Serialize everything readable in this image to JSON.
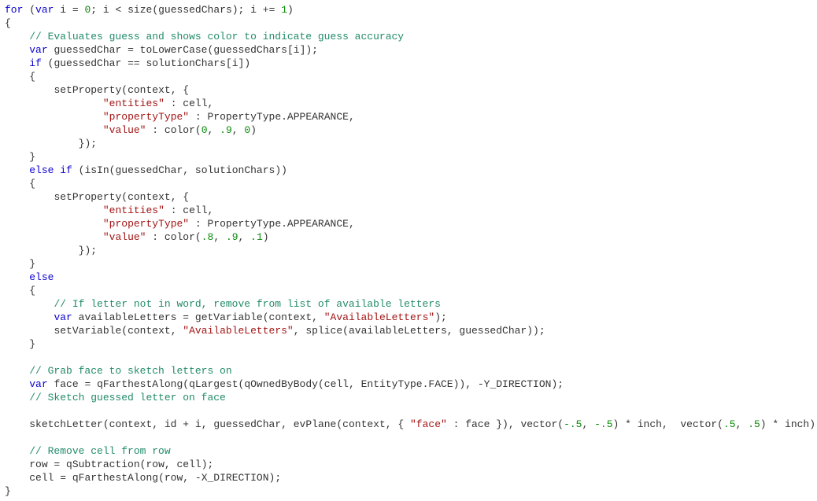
{
  "code": {
    "kw": {
      "for": "for",
      "var": "var",
      "if": "if",
      "elseif": "else if",
      "else": "else"
    },
    "comments": {
      "c1": "// Evaluates guess and shows color to indicate guess accuracy",
      "c2": "// If letter not in word, remove from list of available letters",
      "c3": "// Grab face to sketch letters on",
      "c4": "// Sketch guessed letter on face",
      "c5": "// Remove cell from row"
    },
    "strings": {
      "entities": "\"entities\"",
      "propertyType": "\"propertyType\"",
      "value": "\"value\"",
      "availLetters": "\"AvailableLetters\"",
      "face": "\"face\""
    },
    "nums": {
      "zero": "0",
      "one": "1",
      "p8": ".8",
      "p9": ".9",
      "p1": ".1",
      "p5": ".5",
      "m5": "-.5"
    },
    "tokens": {
      "i": "i",
      "size": "size",
      "guessedChars": "guessedChars",
      "guessedChar": "guessedChar",
      "toLowerCase": "toLowerCase",
      "solutionChars": "solutionChars",
      "setProperty": "setProperty",
      "context": "context",
      "cell": "cell",
      "PropertyTypeAPPEARANCE": "PropertyType.APPEARANCE",
      "color": "color",
      "isIn": "isIn",
      "availableLetters": "availableLetters",
      "getVariable": "getVariable",
      "setVariable": "setVariable",
      "splice": "splice",
      "face": "face",
      "qFarthestAlong": "qFarthestAlong",
      "qLargest": "qLargest",
      "qOwnedByBody": "qOwnedByBody",
      "EntityTypeFACE": "EntityType.FACE",
      "Y_DIRECTION": "-Y_DIRECTION",
      "X_DIRECTION": "-X_DIRECTION",
      "sketchLetter": "sketchLetter",
      "id": "id",
      "evPlane": "evPlane",
      "vector": "vector",
      "inch": "inch",
      "row": "row",
      "qSubtraction": "qSubtraction"
    }
  }
}
